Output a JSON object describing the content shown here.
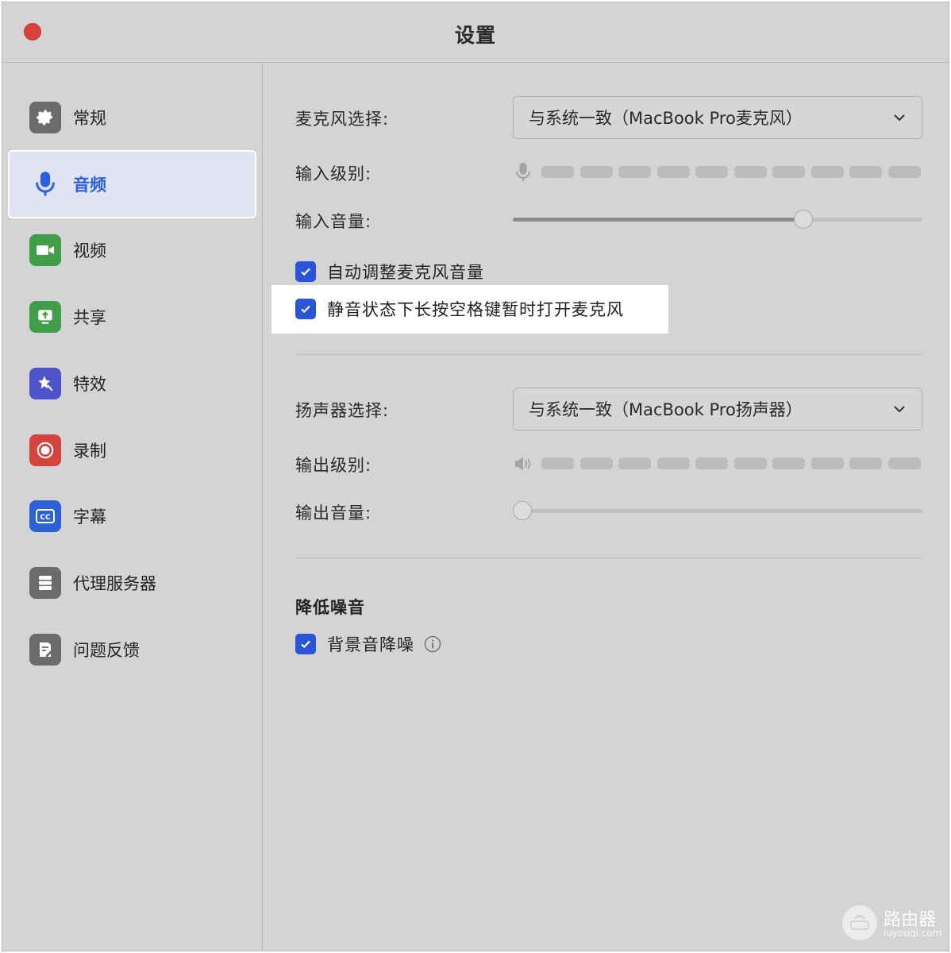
{
  "window": {
    "title": "设置"
  },
  "sidebar": {
    "items": [
      {
        "label": "常规",
        "icon": "gear-icon",
        "color": "#6b6b6b"
      },
      {
        "label": "音频",
        "icon": "microphone-icon",
        "color": "#2e5fe0",
        "active": true
      },
      {
        "label": "视频",
        "icon": "video-camera-icon",
        "color": "#3f9e47"
      },
      {
        "label": "共享",
        "icon": "share-screen-icon",
        "color": "#3f9e47"
      },
      {
        "label": "特效",
        "icon": "effects-star-icon",
        "color": "#4f53c9"
      },
      {
        "label": "录制",
        "icon": "record-icon",
        "color": "#d4433e"
      },
      {
        "label": "字幕",
        "icon": "closed-caption-icon",
        "color": "#2c62d6"
      },
      {
        "label": "代理服务器",
        "icon": "server-icon",
        "color": "#6b6b6b"
      },
      {
        "label": "问题反馈",
        "icon": "feedback-icon",
        "color": "#6b6b6b"
      }
    ]
  },
  "audio": {
    "mic_select_label": "麦克风选择:",
    "mic_select_value": "与系统一致（MacBook Pro麦克风）",
    "input_level_label": "输入级别:",
    "input_level": 0,
    "input_volume_label": "输入音量:",
    "input_volume": 0.72,
    "auto_adjust_label": "自动调整麦克风音量",
    "auto_adjust_checked": true,
    "space_unmute_label": "静音状态下长按空格键暂时打开麦克风",
    "space_unmute_checked": true,
    "speaker_select_label": "扬声器选择:",
    "speaker_select_value": "与系统一致（MacBook Pro扬声器）",
    "output_level_label": "输出级别:",
    "output_level": 0,
    "output_volume_label": "输出音量:",
    "output_volume": 0.0,
    "noise_section_title": "降低噪音",
    "background_noise_label": "背景音降噪",
    "background_noise_checked": true
  },
  "watermark": {
    "title": "路由器",
    "subtitle": "luyouqi.com"
  },
  "colors": {
    "accent": "#2a55d7",
    "close": "#d9423b"
  }
}
